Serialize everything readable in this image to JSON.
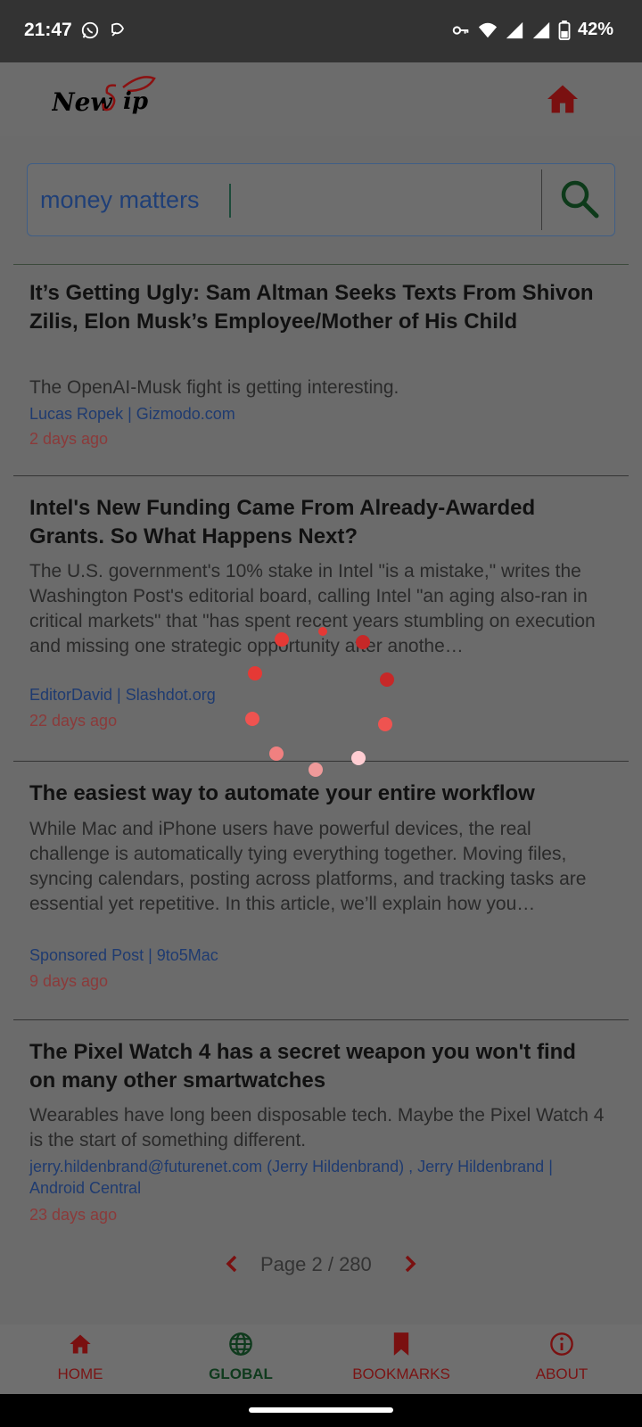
{
  "status_bar": {
    "time": "21:47",
    "battery": "42%",
    "icons": [
      "whatsapp-icon",
      "satellite-icon",
      "vpn-key-icon",
      "wifi-icon",
      "signal-icon",
      "signal-icon",
      "battery-icon"
    ]
  },
  "header": {
    "logo_text": "NewsSip",
    "home_icon": "home-icon"
  },
  "search": {
    "value": "money matters",
    "icon": "search-icon"
  },
  "articles": [
    {
      "title": "It’s Getting Ugly: Sam Altman Seeks Texts From Shivon Zilis, Elon Musk’s Employee/Mother of His Child",
      "description": "The OpenAI-Musk fight is getting interesting.",
      "source": "Lucas Ropek | Gizmodo.com",
      "time": "2 days ago"
    },
    {
      "title": "Intel's New Funding Came From Already-Awarded Grants. So What Happens Next?",
      "description": "The U.S. government's 10% stake in Intel \"is a mistake,\" writes the Washington Post's editorial board, calling Intel \"an aging also-ran in critical markets\" that \"has spent recent years stumbling on execution and missing one strategic opportunity after anothe…",
      "source": "EditorDavid | Slashdot.org",
      "time": "22 days ago"
    },
    {
      "title": "The easiest way to automate your entire workflow",
      "description": "While Mac and iPhone users have powerful devices, the real challenge is automatically tying everything together. Moving files, syncing calendars, posting across platforms, and tracking tasks are essential yet repetitive. In this article, we’ll explain how you…",
      "source": "Sponsored Post | 9to5Mac",
      "time": "9 days ago"
    },
    {
      "title": "The Pixel Watch 4 has a secret weapon you won't find on many other smartwatches",
      "description": "Wearables have long been disposable tech. Maybe the Pixel Watch 4 is the start of something different.",
      "source": "jerry.hildenbrand@futurenet.com (Jerry Hildenbrand) , Jerry Hildenbrand | Android Central",
      "time": "23 days ago"
    }
  ],
  "pagination": {
    "label": "Page 2 / 280"
  },
  "bottom_nav": {
    "items": [
      {
        "label": "HOME",
        "icon": "home-icon",
        "active": false
      },
      {
        "label": "GLOBAL",
        "icon": "globe-icon",
        "active": true
      },
      {
        "label": "BOOKMARKS",
        "icon": "bookmark-icon",
        "active": false
      },
      {
        "label": "ABOUT",
        "icon": "info-icon",
        "active": false
      }
    ]
  },
  "colors": {
    "accent": "#8b1111",
    "active_nav": "#0f3a1d",
    "link": "#1f3b70",
    "spinner": "#e53935"
  }
}
